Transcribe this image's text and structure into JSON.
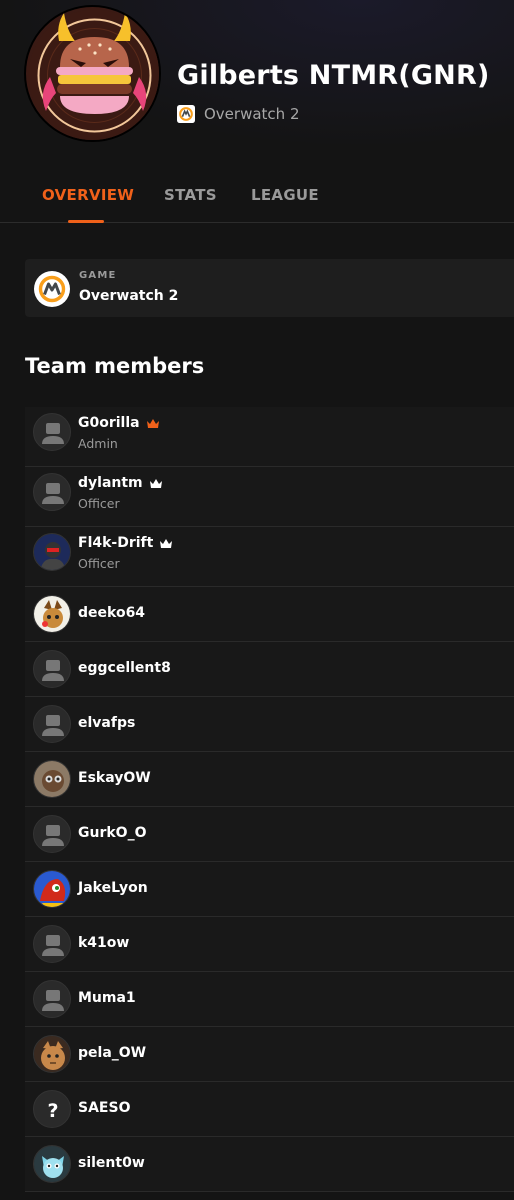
{
  "team": {
    "name": "Gilberts NTMR(GNR)",
    "game": "Overwatch 2"
  },
  "tabs": [
    {
      "label": "OVERVIEW",
      "active": true
    },
    {
      "label": "STATS",
      "active": false
    },
    {
      "label": "LEAGUE",
      "active": false
    }
  ],
  "game_card": {
    "label": "GAME",
    "value": "Overwatch 2"
  },
  "members_title": "Team members",
  "members": [
    {
      "name": "G0orilla",
      "role": "Admin",
      "crown": "orange",
      "avatar": "default-avatar-icon"
    },
    {
      "name": "dylantm",
      "role": "Officer",
      "crown": "white",
      "avatar": "default-avatar-icon"
    },
    {
      "name": "Fl4k-Drift",
      "role": "Officer",
      "crown": "white",
      "avatar": "user-photo"
    },
    {
      "name": "deeko64",
      "role": "",
      "crown": "",
      "avatar": "user-photo"
    },
    {
      "name": "eggcellent8",
      "role": "",
      "crown": "",
      "avatar": "default-avatar-icon"
    },
    {
      "name": "elvafps",
      "role": "",
      "crown": "",
      "avatar": "default-avatar-icon"
    },
    {
      "name": "EskayOW",
      "role": "",
      "crown": "",
      "avatar": "user-photo"
    },
    {
      "name": "GurkO_O",
      "role": "",
      "crown": "",
      "avatar": "default-avatar-icon"
    },
    {
      "name": "JakeLyon",
      "role": "",
      "crown": "",
      "avatar": "user-photo"
    },
    {
      "name": "k41ow",
      "role": "",
      "crown": "",
      "avatar": "default-avatar-icon"
    },
    {
      "name": "Muma1",
      "role": "",
      "crown": "",
      "avatar": "default-avatar-icon"
    },
    {
      "name": "pela_OW",
      "role": "",
      "crown": "",
      "avatar": "user-photo"
    },
    {
      "name": "SAESO",
      "role": "",
      "crown": "",
      "avatar": "question-mark-icon"
    },
    {
      "name": "silent0w",
      "role": "",
      "crown": "",
      "avatar": "user-photo"
    }
  ],
  "colors": {
    "accent": "#f0611a",
    "background": "#141414",
    "card": "#1e1e1e",
    "muted_text": "#9a9a9a"
  }
}
